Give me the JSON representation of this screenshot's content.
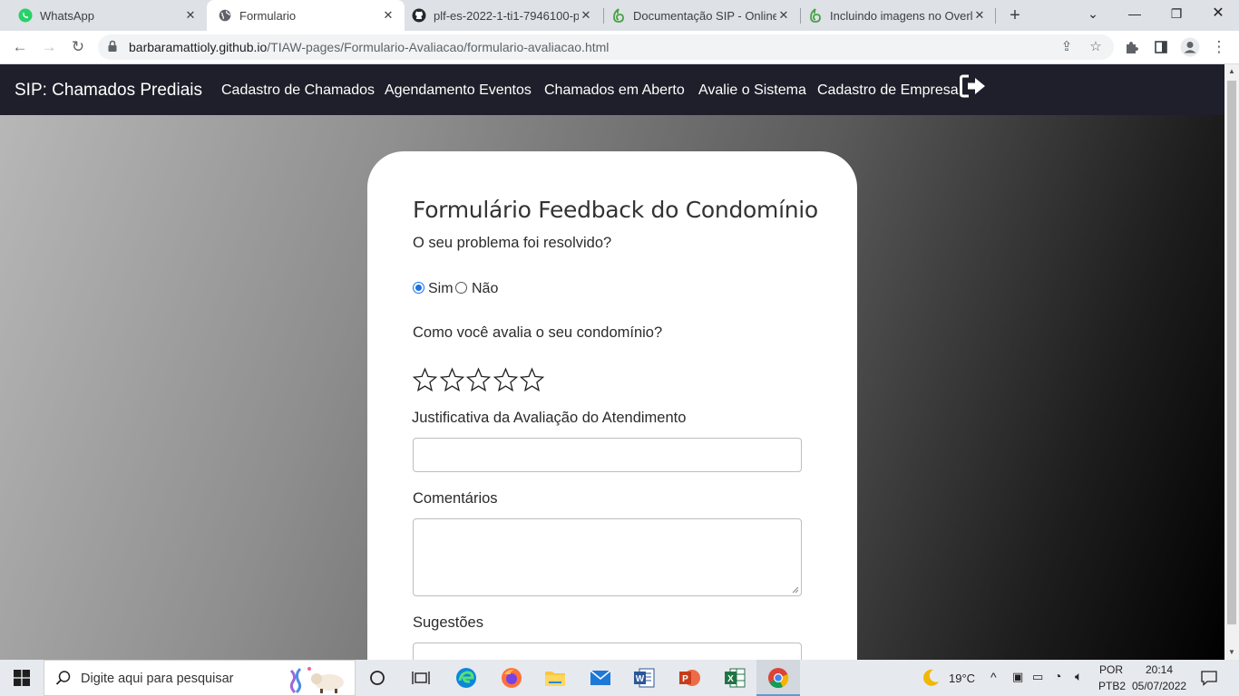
{
  "browser": {
    "tabs": [
      {
        "title": "WhatsApp",
        "icon": "whatsapp-icon",
        "active": false
      },
      {
        "title": "Formulario",
        "icon": "globe-icon",
        "active": true
      },
      {
        "title": "plf-es-2022-1-ti1-7946100-p",
        "icon": "github-icon",
        "active": false
      },
      {
        "title": "Documentação SIP - Online L",
        "icon": "overleaf-icon",
        "active": false
      },
      {
        "title": "Incluindo imagens no Overle",
        "icon": "overleaf-icon",
        "active": false
      }
    ],
    "new_tab": "+",
    "url_host": "barbaramattioly.github.io",
    "url_path": "/TIAW-pages/Formulario-Avaliacao/formulario-avaliacao.html"
  },
  "navbar": {
    "brand": "SIP: Chamados Prediais",
    "links": [
      "Cadastro de Chamados",
      "Agendamento Eventos",
      "Chamados em Aberto",
      "Avalie o Sistema",
      "Cadastro de Empresa"
    ]
  },
  "form": {
    "title": "Formulário Feedback do Condomínio",
    "q1": "O seu problema foi resolvido?",
    "opt_yes": "Sim",
    "opt_no": "Não",
    "selected": "Sim",
    "q2": "Como você avalia o seu condomínio?",
    "rating_max": 5,
    "rating_value": 0,
    "justificativa_label": "Justificativa da Avaliação do Atendimento",
    "justificativa_value": "",
    "comentarios_label": "Comentários",
    "comentarios_value": "",
    "sugestoes_label": "Sugestões"
  },
  "taskbar": {
    "search_placeholder": "Digite aqui para pesquisar",
    "weather": "19°C",
    "lang_top": "POR",
    "lang_bottom": "PTB2",
    "time": "20:14",
    "date": "05/07/2022"
  }
}
